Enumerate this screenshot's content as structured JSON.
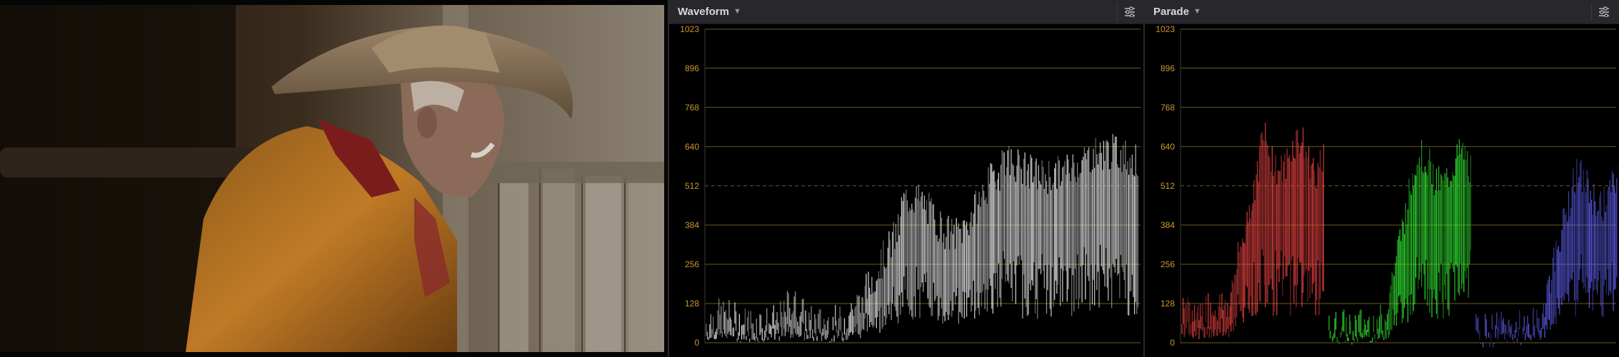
{
  "waveform": {
    "title": "Waveform",
    "ticks": [
      "1023",
      "896",
      "768",
      "640",
      "512",
      "384",
      "256",
      "128",
      "0"
    ]
  },
  "parade": {
    "title": "Parade",
    "ticks": [
      "1023",
      "896",
      "768",
      "640",
      "512",
      "384",
      "256",
      "128",
      "0"
    ]
  },
  "colors": {
    "panel_bg": "#28282c",
    "grid": "#6f5a1e",
    "tick_label": "#c99a2c",
    "trace_white": "#ffffff",
    "trace_red": "#ff4a4a",
    "trace_green": "#39ff39",
    "trace_blue": "#6666ff"
  }
}
